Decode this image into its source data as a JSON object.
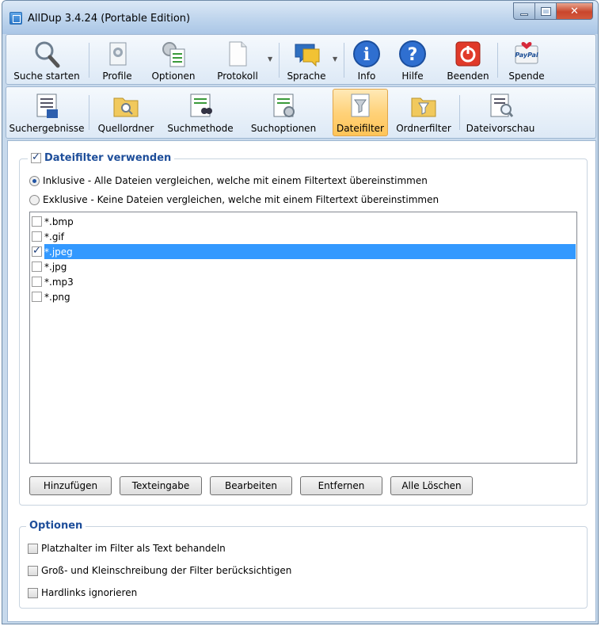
{
  "window": {
    "title": "AllDup 3.4.24 (Portable Edition)"
  },
  "toolbar": {
    "items": [
      {
        "label": "Suche starten",
        "icon": "magnifier-icon"
      },
      {
        "label": "Profile",
        "icon": "profile-icon"
      },
      {
        "label": "Optionen",
        "icon": "options-icon"
      },
      {
        "label": "Protokoll",
        "icon": "document-icon"
      },
      {
        "label": "Sprache",
        "icon": "language-icon"
      },
      {
        "label": "Info",
        "icon": "info-icon"
      },
      {
        "label": "Hilfe",
        "icon": "help-icon"
      },
      {
        "label": "Beenden",
        "icon": "power-icon"
      },
      {
        "label": "Spende",
        "icon": "paypal-icon"
      }
    ]
  },
  "tabs": {
    "items": [
      {
        "label": "Suchergebnisse"
      },
      {
        "label": "Quellordner"
      },
      {
        "label": "Suchmethode"
      },
      {
        "label": "Suchoptionen"
      },
      {
        "label": "Dateifilter"
      },
      {
        "label": "Ordnerfilter"
      },
      {
        "label": "Dateivorschau"
      }
    ],
    "active": "Dateifilter"
  },
  "filter": {
    "enable_label": "Dateifilter verwenden",
    "enabled": true,
    "inclusive_label": "Inklusive - Alle Dateien vergleichen, welche mit einem Filtertext übereinstimmen",
    "exclusive_label": "Exklusive - Keine Dateien vergleichen, welche mit einem Filtertext übereinstimmen",
    "mode": "inclusive",
    "items": [
      {
        "text": "*.bmp",
        "checked": false
      },
      {
        "text": "*.gif",
        "checked": false
      },
      {
        "text": "*.jpeg",
        "checked": true
      },
      {
        "text": "*.jpg",
        "checked": false
      },
      {
        "text": "*.mp3",
        "checked": false
      },
      {
        "text": "*.png",
        "checked": false
      }
    ],
    "selected_index": 2,
    "buttons": {
      "add": "Hinzufügen",
      "text_input": "Texteingabe",
      "edit": "Bearbeiten",
      "remove": "Entfernen",
      "delete_all": "Alle Löschen"
    }
  },
  "options": {
    "title": "Optionen",
    "items": [
      {
        "label": "Platzhalter im Filter als Text behandeln",
        "checked": false
      },
      {
        "label": "Groß- und Kleinschreibung der Filter berücksichtigen",
        "checked": false
      },
      {
        "label": "Hardlinks ignorieren",
        "checked": false
      }
    ]
  },
  "colors": {
    "accent": "#1e4e9a",
    "selection": "#3399ff",
    "active_tab": "#ffd27a"
  }
}
